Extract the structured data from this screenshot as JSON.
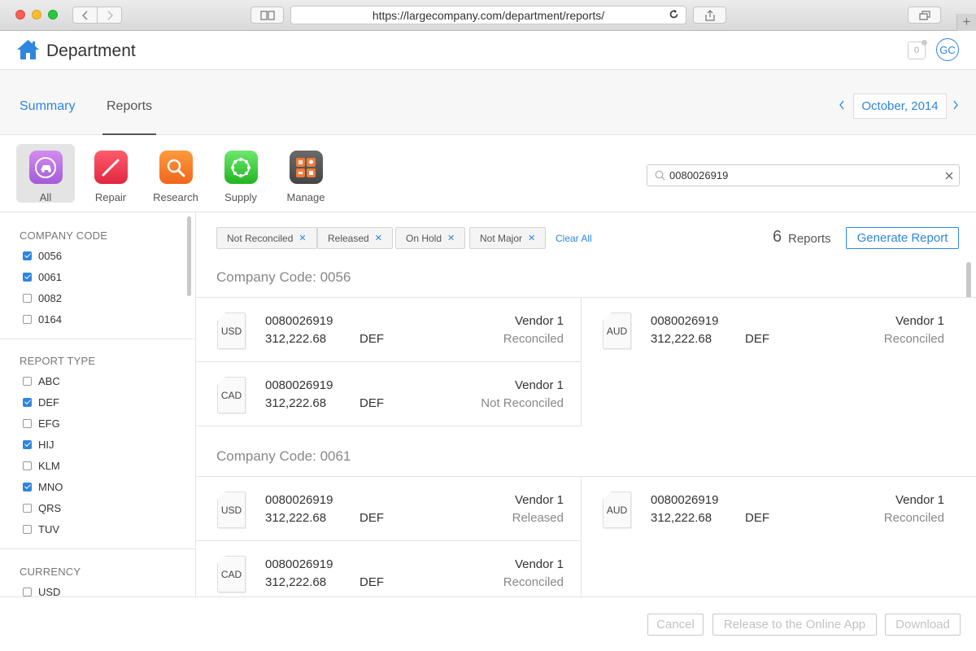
{
  "browser": {
    "url": "https://largecompany.com/department/reports/",
    "icons": [
      "back-icon",
      "forward-icon",
      "reader-icon",
      "reload-icon",
      "share-icon",
      "tabs-icon",
      "new-tab-icon"
    ]
  },
  "header": {
    "title": "Department",
    "notification_count": "0",
    "avatar_initials": "GC"
  },
  "tabs": [
    {
      "label": "Summary"
    },
    {
      "label": "Reports",
      "active": true
    }
  ],
  "period": {
    "label": "October, 2014"
  },
  "categories": [
    {
      "label": "All",
      "icon": "all-icon",
      "color": "#b56fe0",
      "selected": true
    },
    {
      "label": "Repair",
      "icon": "repair-icon",
      "color": "#f0384c"
    },
    {
      "label": "Research",
      "icon": "research-icon",
      "color": "#f7792a"
    },
    {
      "label": "Supply",
      "icon": "supply-icon",
      "color": "#3dcf3d"
    },
    {
      "label": "Manage",
      "icon": "manage-icon",
      "color": "#5b5b5b"
    }
  ],
  "search": {
    "value": "0080026919"
  },
  "filters": {
    "company_code": {
      "title": "COMPANY CODE",
      "items": [
        {
          "label": "0056",
          "checked": true
        },
        {
          "label": "0061",
          "checked": true
        },
        {
          "label": "0082",
          "checked": false
        },
        {
          "label": "0164",
          "checked": false
        }
      ]
    },
    "report_type": {
      "title": "REPORT TYPE",
      "items": [
        {
          "label": "ABC",
          "checked": false
        },
        {
          "label": "DEF",
          "checked": true
        },
        {
          "label": "EFG",
          "checked": false
        },
        {
          "label": "HIJ",
          "checked": true
        },
        {
          "label": "KLM",
          "checked": false
        },
        {
          "label": "MNO",
          "checked": true
        },
        {
          "label": "QRS",
          "checked": false
        },
        {
          "label": "TUV",
          "checked": false
        }
      ]
    },
    "currency": {
      "title": "CURRENCY",
      "items": [
        {
          "label": "USD",
          "checked": false
        }
      ]
    }
  },
  "chips": [
    {
      "label": "Not Reconciled"
    },
    {
      "label": "Released"
    },
    {
      "label": "On Hold"
    },
    {
      "label": "Not Major"
    }
  ],
  "clear_all": "Clear All",
  "report_count": {
    "number": "6",
    "label": "Reports"
  },
  "generate_label": "Generate Report",
  "groups": [
    {
      "title": "Company Code: 0056",
      "reports": [
        {
          "currency": "USD",
          "id": "0080026919",
          "amount": "312,222.68",
          "type": "DEF",
          "vendor": "Vendor 1",
          "status": "Reconciled"
        },
        {
          "currency": "AUD",
          "id": "0080026919",
          "amount": "312,222.68",
          "type": "DEF",
          "vendor": "Vendor 1",
          "status": "Reconciled"
        },
        {
          "currency": "CAD",
          "id": "0080026919",
          "amount": "312,222.68",
          "type": "DEF",
          "vendor": "Vendor 1",
          "status": "Not Reconciled"
        }
      ]
    },
    {
      "title": "Company Code: 0061",
      "reports": [
        {
          "currency": "USD",
          "id": "0080026919",
          "amount": "312,222.68",
          "type": "DEF",
          "vendor": "Vendor 1",
          "status": "Released"
        },
        {
          "currency": "AUD",
          "id": "0080026919",
          "amount": "312,222.68",
          "type": "DEF",
          "vendor": "Vendor 1",
          "status": "Reconciled"
        },
        {
          "currency": "CAD",
          "id": "0080026919",
          "amount": "312,222.68",
          "type": "DEF",
          "vendor": "Vendor 1",
          "status": "Reconciled"
        }
      ]
    }
  ],
  "footer": {
    "cancel": "Cancel",
    "release": "Release to the Online App",
    "download": "Download"
  },
  "colors": {
    "accent": "#2e86de"
  }
}
